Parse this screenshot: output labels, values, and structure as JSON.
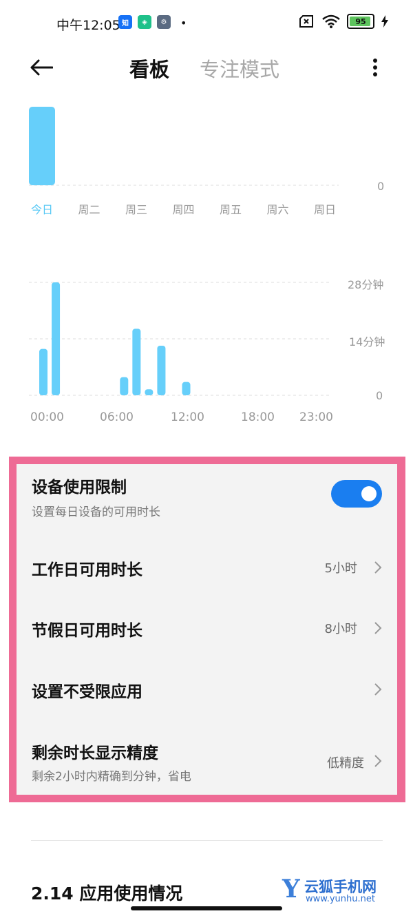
{
  "status": {
    "time": "中午12:05",
    "battery": "95",
    "apps": [
      "zhihu-icon",
      "shield-app-icon",
      "settings-app-icon"
    ]
  },
  "header": {
    "tabs": [
      {
        "label": "看板",
        "active": true
      },
      {
        "label": "专注模式",
        "active": false
      }
    ]
  },
  "weekly_chart": {
    "chart_data": {
      "type": "bar",
      "categories": [
        "今日",
        "周二",
        "周三",
        "周四",
        "周五",
        "周六",
        "周日"
      ],
      "values": [
        1,
        0,
        0,
        0,
        0,
        0,
        0
      ],
      "y_tick": "0"
    }
  },
  "hourly_chart": {
    "chart_data": {
      "type": "bar",
      "x_ticks": [
        "00:00",
        "06:00",
        "12:00",
        "18:00",
        "23:00"
      ],
      "y_ticks": [
        "28分钟",
        "14分钟",
        "0"
      ],
      "ylim": [
        0,
        28
      ],
      "hours": [
        0.5,
        1.5,
        7.0,
        8.0,
        9.0,
        10.0,
        12.0
      ],
      "values": [
        11.5,
        28,
        4.5,
        16.5,
        1.5,
        12.3,
        3.3
      ]
    }
  },
  "settings": {
    "device_limit": {
      "title": "设备使用限制",
      "subtitle": "设置每日设备的可用时长",
      "enabled": true
    },
    "workday": {
      "title": "工作日可用时长",
      "value": "5小时"
    },
    "holiday": {
      "title": "节假日可用时长",
      "value": "8小时"
    },
    "unrestricted_apps": {
      "title": "设置不受限应用"
    },
    "precision": {
      "title": "剩余时长显示精度",
      "subtitle": "剩余2小时内精确到分钟，省电",
      "value": "低精度"
    }
  },
  "section": {
    "title": "2.14 应用使用情况"
  },
  "watermark": {
    "letter": "Y",
    "name": "云狐手机网",
    "url": "www.yunhu.net"
  },
  "colors": {
    "accent": "#1a7ef0",
    "bar": "#66cffa",
    "highlight": "#ee6b95"
  }
}
